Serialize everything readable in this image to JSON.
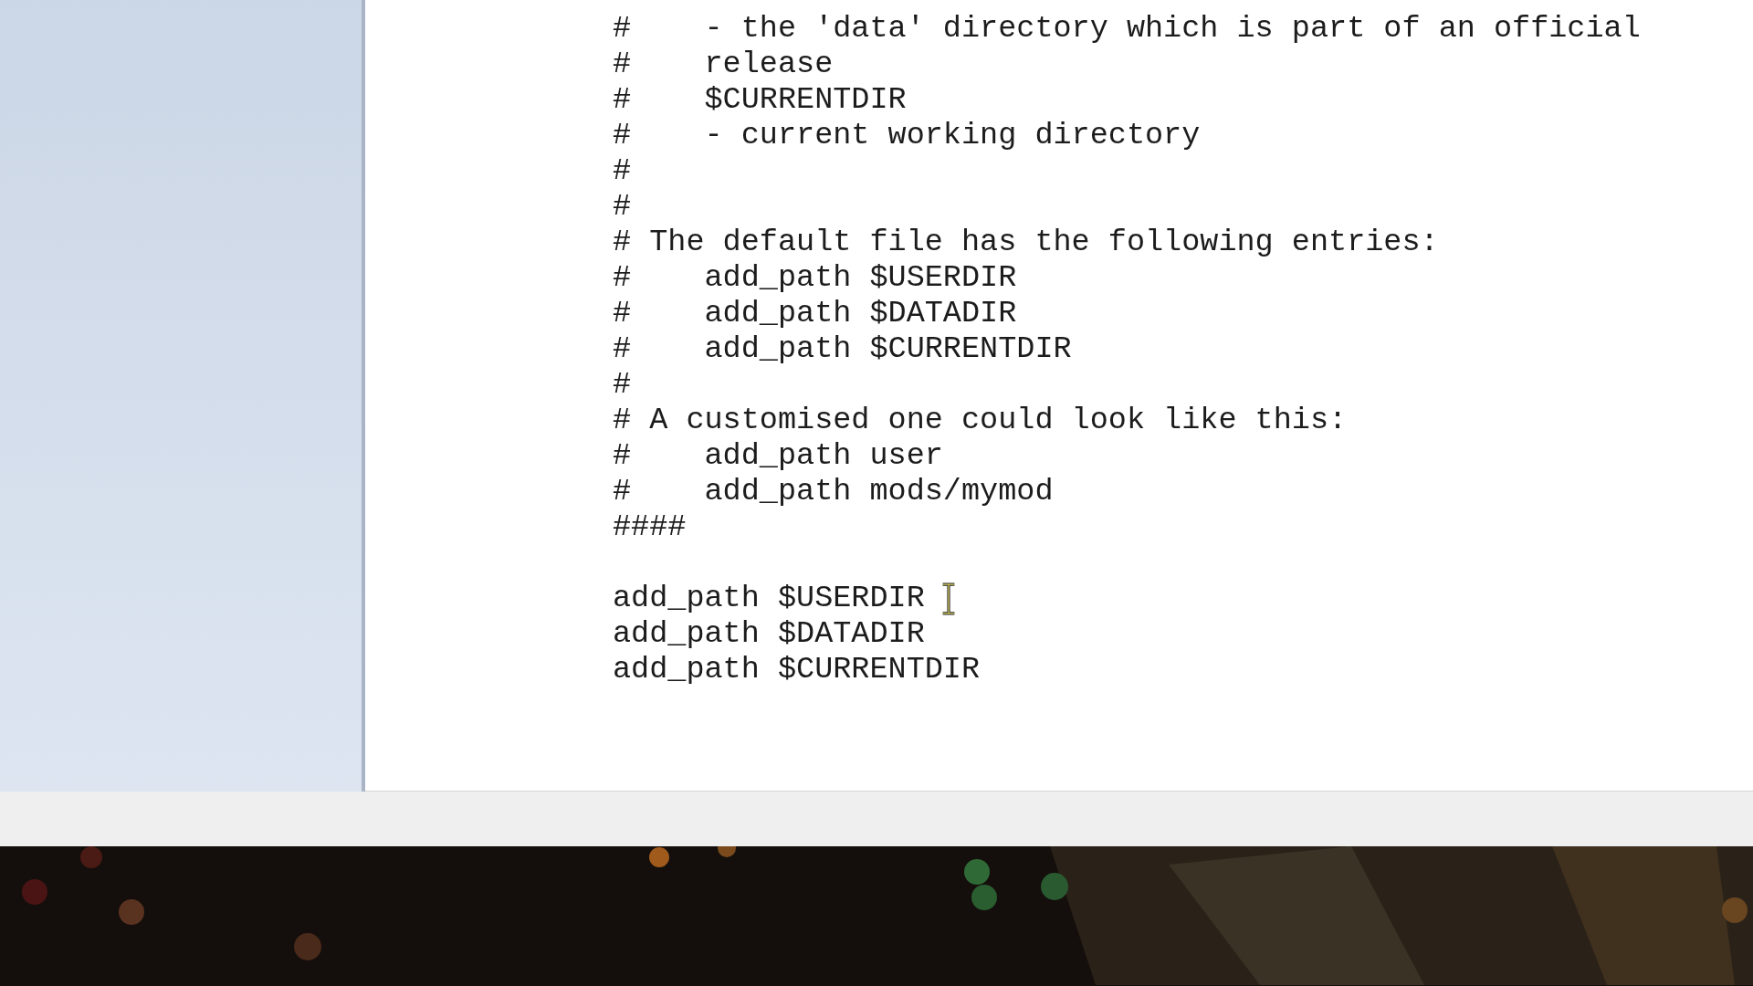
{
  "editor": {
    "lines": [
      {
        "kind": "text",
        "text": "#    - the 'data' directory which is part of an official"
      },
      {
        "kind": "text",
        "text": "#    release"
      },
      {
        "kind": "text",
        "text": "#    $CURRENTDIR"
      },
      {
        "kind": "text",
        "text": "#    - current working directory"
      },
      {
        "kind": "text",
        "text": "#"
      },
      {
        "kind": "text",
        "text": "#"
      },
      {
        "kind": "text",
        "text": "# The default file has the following entries:"
      },
      {
        "kind": "text",
        "text": "#    add_path $USERDIR"
      },
      {
        "kind": "text",
        "text": "#    add_path $DATADIR"
      },
      {
        "kind": "text",
        "text": "#    add_path $CURRENTDIR"
      },
      {
        "kind": "text",
        "text": "#"
      },
      {
        "kind": "text",
        "text": "# A customised one could look like this:"
      },
      {
        "kind": "text",
        "text": "#    add_path user"
      },
      {
        "kind": "text",
        "text": "#    add_path mods/mymod"
      },
      {
        "kind": "text",
        "text": "####"
      },
      {
        "kind": "blank"
      },
      {
        "kind": "text",
        "text": "add_path $USERDIR"
      },
      {
        "kind": "text",
        "text": "add_path $DATADIR"
      },
      {
        "kind": "text",
        "text": "add_path $CURRENTDIR"
      }
    ]
  }
}
